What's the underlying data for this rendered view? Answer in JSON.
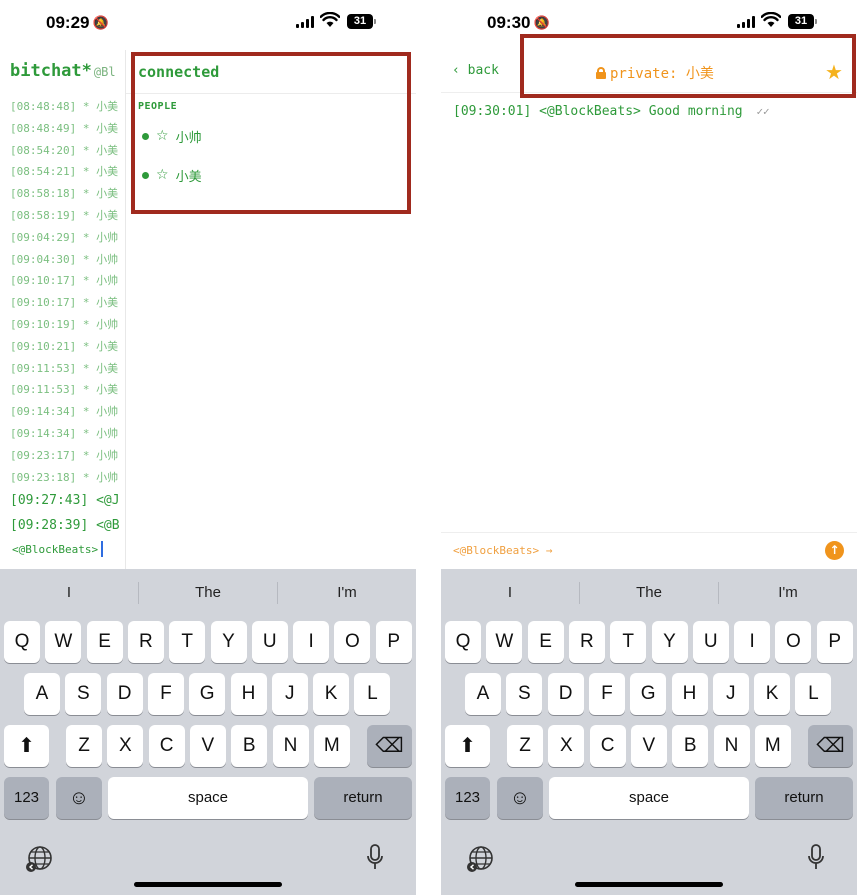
{
  "left_phone": {
    "status": {
      "time": "09:29",
      "battery": "31"
    },
    "chat": {
      "brand": "bitchat*",
      "nick_fragment": "@Bl",
      "lines": [
        {
          "ts": "[08:48:48]",
          "text": " * 小美"
        },
        {
          "ts": "[08:48:49]",
          "text": " * 小美"
        },
        {
          "ts": "[08:54:20]",
          "text": " * 小美"
        },
        {
          "ts": "[08:54:21]",
          "text": " * 小美"
        },
        {
          "ts": "[08:58:18]",
          "text": " * 小美"
        },
        {
          "ts": "[08:58:19]",
          "text": " * 小美"
        },
        {
          "ts": "[09:04:29]",
          "text": " * 小帅"
        },
        {
          "ts": "[09:04:30]",
          "text": " * 小帅"
        },
        {
          "ts": "[09:10:17]",
          "text": " * 小帅"
        },
        {
          "ts": "[09:10:17]",
          "text": " * 小美"
        },
        {
          "ts": "[09:10:19]",
          "text": " * 小帅"
        },
        {
          "ts": "[09:10:21]",
          "text": " * 小美"
        },
        {
          "ts": "[09:11:53]",
          "text": " * 小美"
        },
        {
          "ts": "[09:11:53]",
          "text": " * 小美"
        },
        {
          "ts": "[09:14:34]",
          "text": " * 小帅"
        },
        {
          "ts": "[09:14:34]",
          "text": " * 小帅"
        },
        {
          "ts": "[09:23:17]",
          "text": " * 小帅"
        },
        {
          "ts": "[09:23:18]",
          "text": " * 小帅"
        }
      ],
      "recent_lines": [
        {
          "ts": "[09:27:43]",
          "text": " <@J"
        },
        {
          "ts": "[09:28:39]",
          "text": " <@B"
        }
      ],
      "input_prompt": "<@BlockBeats>"
    },
    "sidebar": {
      "title": "connected",
      "section": "PEOPLE",
      "peers": [
        {
          "star": "☆",
          "name": "小帅"
        },
        {
          "star": "☆",
          "name": "小美"
        }
      ]
    }
  },
  "right_phone": {
    "status": {
      "time": "09:30",
      "battery": "31"
    },
    "nav": {
      "back": "‹ back",
      "title": "private: 小美",
      "favorite_star": "★"
    },
    "message": {
      "ts": "[09:30:01]",
      "sender": "<@BlockBeats>",
      "body": "Good morning",
      "ticks": "✓✓"
    },
    "input_prompt": "<@BlockBeats> →",
    "send_glyph": "↑"
  },
  "keyboard": {
    "suggestions": [
      "I",
      "The",
      "I'm"
    ],
    "row1": [
      "Q",
      "W",
      "E",
      "R",
      "T",
      "Y",
      "U",
      "I",
      "O",
      "P"
    ],
    "row2": [
      "A",
      "S",
      "D",
      "F",
      "G",
      "H",
      "J",
      "K",
      "L"
    ],
    "row3": [
      "Z",
      "X",
      "C",
      "V",
      "B",
      "N",
      "M"
    ],
    "numbers_label": "123",
    "emoji_glyph": "☺",
    "space_label": "space",
    "return_label": "return",
    "shift_glyph": "⬆",
    "delete_glyph": "⌫"
  },
  "colors": {
    "terminal_green": "#2e9a3a",
    "private_orange": "#f0941c",
    "favorite_yellow": "#f5b21c",
    "highlight_red": "#a02a1e",
    "keyboard_bg": "#d1d4da"
  }
}
